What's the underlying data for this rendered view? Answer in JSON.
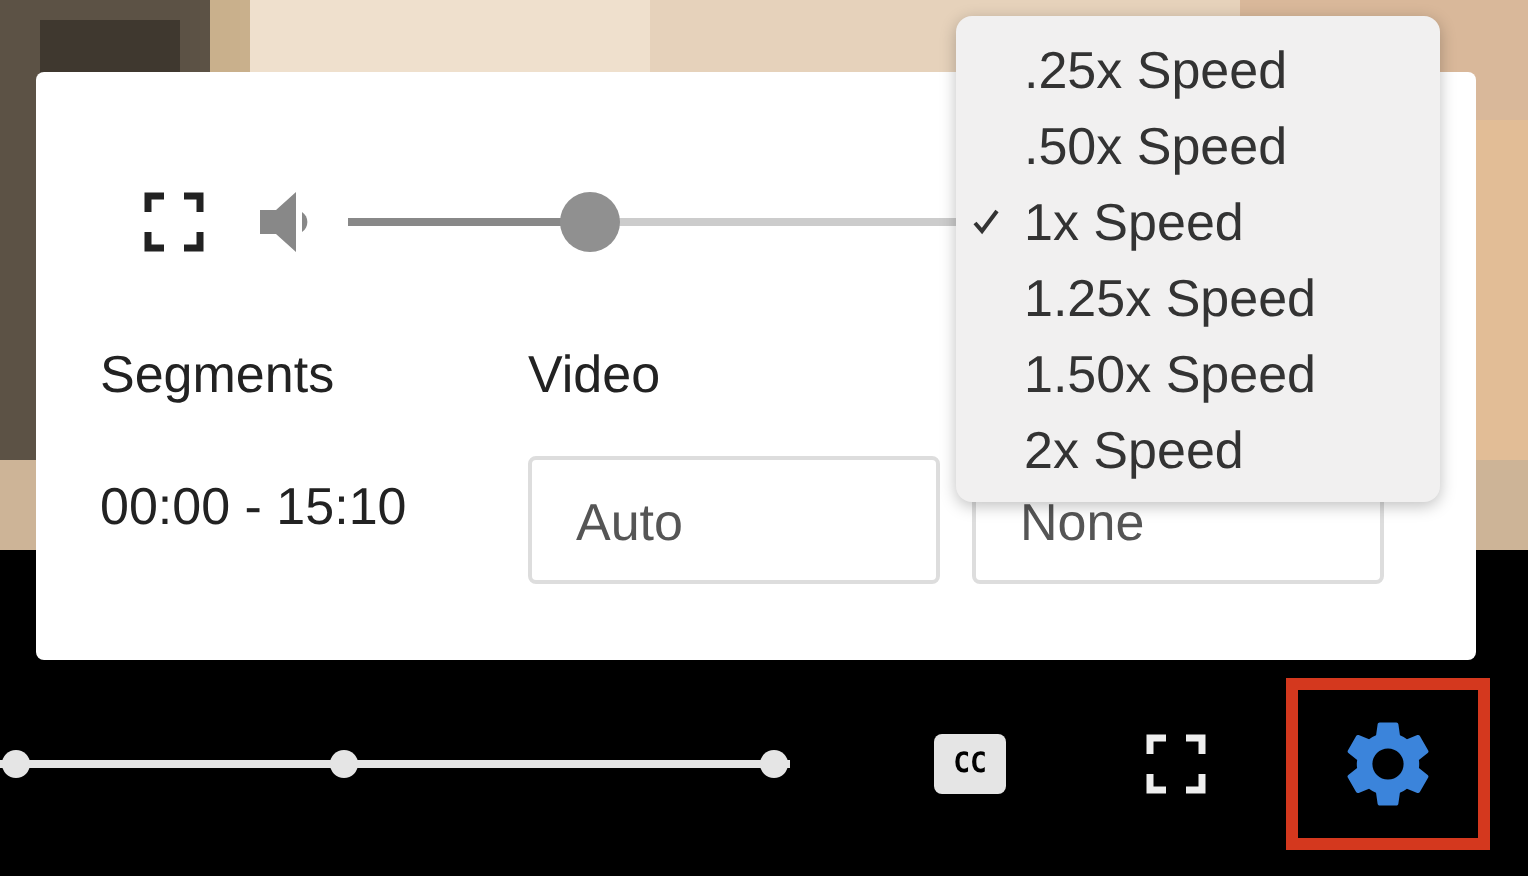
{
  "panel": {
    "volume": {
      "level": 0.23
    },
    "segments": {
      "label": "Segments",
      "range": "00:00 - 15:10"
    },
    "video": {
      "label": "Video",
      "value": "Auto"
    },
    "select_2": {
      "value": "None"
    }
  },
  "speed_menu": {
    "items": [
      {
        "label": ".25x Speed",
        "selected": false
      },
      {
        "label": ".50x Speed",
        "selected": false
      },
      {
        "label": "1x Speed",
        "selected": true
      },
      {
        "label": "1.25x Speed",
        "selected": false
      },
      {
        "label": "1.50x Speed",
        "selected": false
      },
      {
        "label": "2x Speed",
        "selected": false
      }
    ]
  },
  "controls": {
    "cc_label": "CC",
    "settings": {
      "highlighted": true
    }
  }
}
